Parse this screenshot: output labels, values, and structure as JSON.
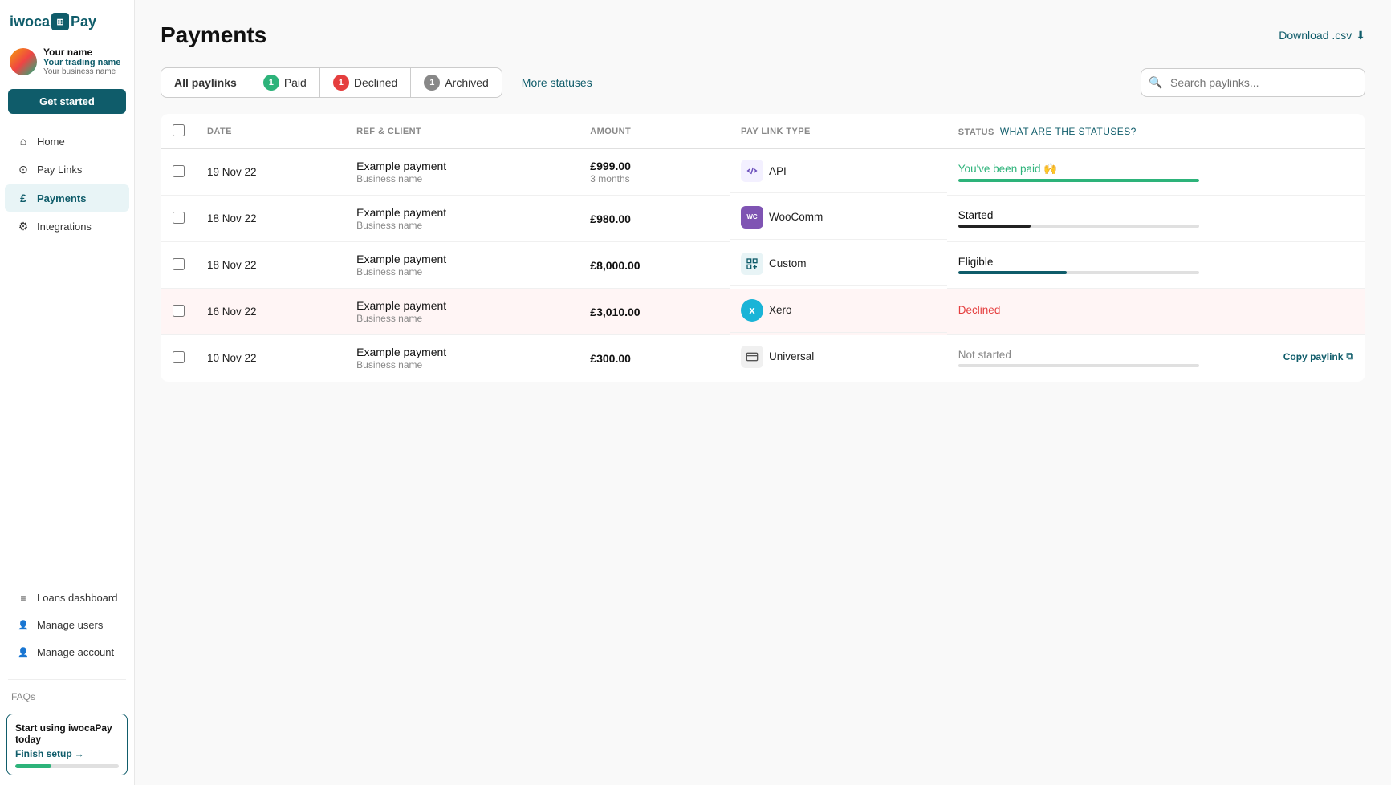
{
  "brand": {
    "name_part1": "iwoca",
    "name_part2": "Pay"
  },
  "sidebar": {
    "user": {
      "name": "Your name",
      "trading_name": "Your trading name",
      "business_name": "Your business name"
    },
    "get_started_label": "Get started",
    "nav": [
      {
        "id": "home",
        "label": "Home",
        "icon": "⌂"
      },
      {
        "id": "paylinks",
        "label": "Pay Links",
        "icon": "⊙"
      },
      {
        "id": "payments",
        "label": "Payments",
        "icon": "£",
        "active": true
      },
      {
        "id": "integrations",
        "label": "Integrations",
        "icon": "⚙"
      }
    ],
    "bottom_nav": [
      {
        "id": "loans",
        "label": "Loans dashboard",
        "icon": "≡"
      },
      {
        "id": "manage_users",
        "label": "Manage users",
        "icon": "👤"
      },
      {
        "id": "manage_account",
        "label": "Manage account",
        "icon": "👤"
      }
    ],
    "faqs_label": "FAQs",
    "setup_banner": {
      "title": "Start using iwocaPay today",
      "link_label": "Finish setup",
      "progress_percent": 35
    }
  },
  "page": {
    "title": "Payments",
    "download_label": "Download .csv"
  },
  "filters": {
    "tabs": [
      {
        "id": "all",
        "label": "All paylinks",
        "badge": null,
        "active": true
      },
      {
        "id": "paid",
        "label": "Paid",
        "badge": "1",
        "badge_color": "green"
      },
      {
        "id": "declined",
        "label": "Declined",
        "badge": "1",
        "badge_color": "red"
      },
      {
        "id": "archived",
        "label": "Archived",
        "badge": "1",
        "badge_color": "gray"
      }
    ],
    "more_statuses_label": "More statuses",
    "search_placeholder": "Search paylinks..."
  },
  "table": {
    "columns": [
      "DATE",
      "REF & CLIENT",
      "AMOUNT",
      "PAY LINK TYPE",
      "STATUS"
    ],
    "status_help_label": "What are the statuses?",
    "rows": [
      {
        "date": "19 Nov 22",
        "ref": "Example payment",
        "client": "Business name",
        "amount": "£999.00",
        "duration": "3 months",
        "paylink_type": "API",
        "paylink_icon": "api",
        "status": "You've been paid 🙌",
        "status_type": "paid",
        "progress": 100,
        "declined": false
      },
      {
        "date": "18 Nov 22",
        "ref": "Example payment",
        "client": "Business name",
        "amount": "£980.00",
        "duration": null,
        "paylink_type": "WooComm",
        "paylink_icon": "woo",
        "status": "Started",
        "status_type": "started",
        "progress": 30,
        "declined": false
      },
      {
        "date": "18 Nov 22",
        "ref": "Example payment",
        "client": "Business name",
        "amount": "£8,000.00",
        "duration": null,
        "paylink_type": "Custom",
        "paylink_icon": "custom",
        "status": "Eligible",
        "status_type": "eligible",
        "progress": 45,
        "declined": false
      },
      {
        "date": "16 Nov 22",
        "ref": "Example payment",
        "client": "Business name",
        "amount": "£3,010.00",
        "duration": null,
        "paylink_type": "Xero",
        "paylink_icon": "xero",
        "status": "Declined",
        "status_type": "declined",
        "progress": 0,
        "declined": true
      },
      {
        "date": "10 Nov 22",
        "ref": "Example payment",
        "client": "Business name",
        "amount": "£300.00",
        "duration": null,
        "paylink_type": "Universal",
        "paylink_icon": "universal",
        "status": "Not started",
        "status_type": "not-started",
        "progress": 0,
        "declined": false,
        "copy_paylink": true
      }
    ]
  }
}
